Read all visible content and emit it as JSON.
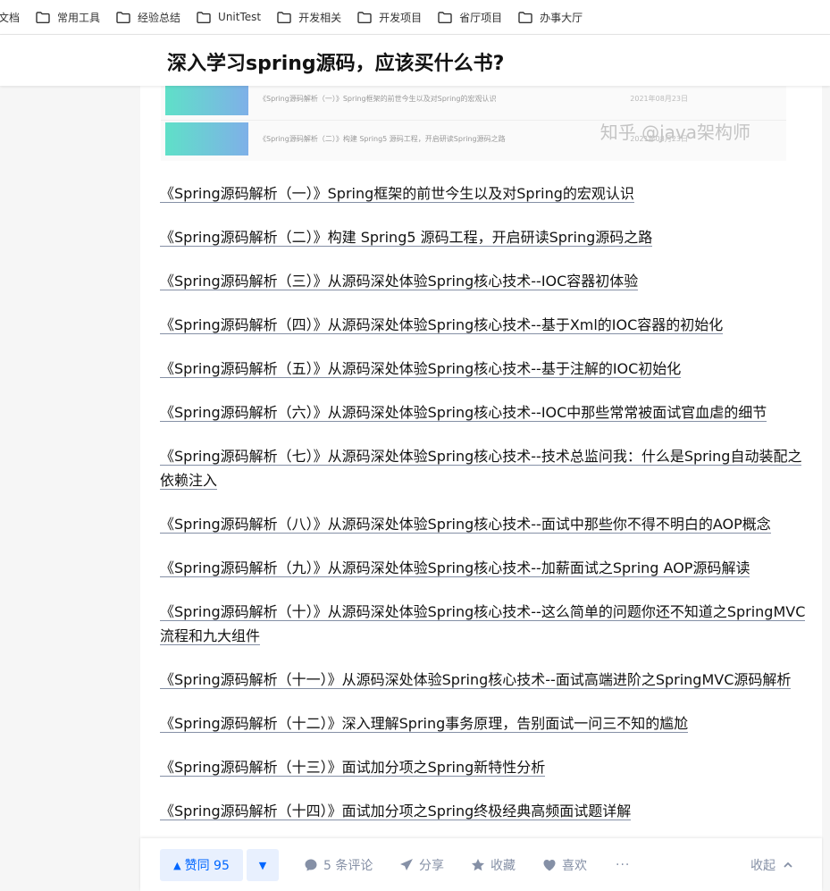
{
  "bookmarks": [
    {
      "label": "文档",
      "icon": "folder-icon"
    },
    {
      "label": "常用工具",
      "icon": "folder-icon"
    },
    {
      "label": "经验总结",
      "icon": "folder-icon"
    },
    {
      "label": "UnitTest",
      "icon": "folder-icon"
    },
    {
      "label": "开发相关",
      "icon": "folder-icon"
    },
    {
      "label": "开发项目",
      "icon": "folder-icon"
    },
    {
      "label": "省厅项目",
      "icon": "folder-icon"
    },
    {
      "label": "办事大厅",
      "icon": "folder-icon"
    }
  ],
  "question": {
    "title": "深入学习spring源码，应该买什么书?"
  },
  "image": {
    "rows": [
      {
        "text": "《Spring源码解析（一）》Spring框架的前世今生以及对Spring的宏观认识",
        "date": "2021年08月23日"
      },
      {
        "text": "《Spring源码解析（二）》构建 Spring5 源码工程，开启研读Spring源码之路",
        "date": "2021年08月23日"
      }
    ],
    "watermark": "知乎 @java架构师"
  },
  "article": {
    "links": [
      "《Spring源码解析（一）》Spring框架的前世今生以及对Spring的宏观认识",
      "《Spring源码解析（二）》构建 Spring5 源码工程，开启研读Spring源码之路",
      "《Spring源码解析（三）》从源码深处体验Spring核心技术--IOC容器初体验",
      "《Spring源码解析（四）》从源码深处体验Spring核心技术--基于Xml的IOC容器的初始化",
      "《Spring源码解析（五）》从源码深处体验Spring核心技术--基于注解的IOC初始化",
      "《Spring源码解析（六）》从源码深处体验Spring核心技术--IOC中那些常常被面试官血虐的细节",
      "《Spring源码解析（七）》从源码深处体验Spring核心技术--技术总监问我：什么是Spring自动装配之依赖注入",
      "《Spring源码解析（八）》从源码深处体验Spring核心技术--面试中那些你不得不明白的AOP概念",
      "《Spring源码解析（九）》从源码深处体验Spring核心技术--加薪面试之Spring AOP源码解读",
      "《Spring源码解析（十）》从源码深处体验Spring核心技术--这么简单的问题你还不知道之SpringMVC流程和九大组件",
      "《Spring源码解析（十一）》从源码深处体验Spring核心技术--面试高端进阶之SpringMVC源码解析",
      "《Spring源码解析（十二）》深入理解Spring事务原理，告别面试一问三不知的尴尬",
      "《Spring源码解析（十三）》面试加分项之Spring新特性分析",
      "《Spring源码解析（十四）》面试加分项之Spring终极经典高频面试题详解"
    ]
  },
  "actions": {
    "vote_up_label": "赞同 95",
    "comment_label": "5 条评论",
    "share_label": "分享",
    "favorite_label": "收藏",
    "like_label": "喜欢",
    "more_label": "···",
    "collapse_label": "收起"
  },
  "colors": {
    "accent": "#0066ff",
    "muted": "#8590a6",
    "text": "#121212"
  }
}
